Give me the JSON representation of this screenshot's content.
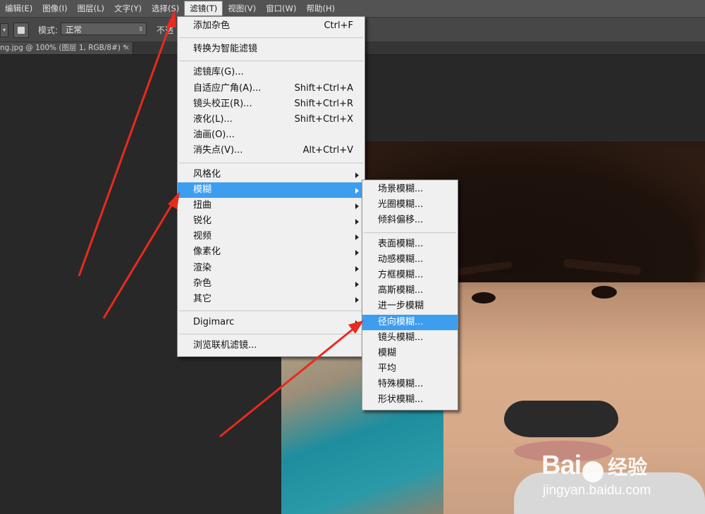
{
  "menubar": {
    "items": [
      {
        "label": "编辑(E)"
      },
      {
        "label": "图像(I)"
      },
      {
        "label": "图层(L)"
      },
      {
        "label": "文字(Y)"
      },
      {
        "label": "选择(S)"
      },
      {
        "label": "滤镜(T)"
      },
      {
        "label": "视图(V)"
      },
      {
        "label": "窗口(W)"
      },
      {
        "label": "帮助(H)"
      }
    ]
  },
  "options": {
    "mode_label": "模式:",
    "mode_value": "正常",
    "opacity_label": "不透"
  },
  "document": {
    "tab_title": "ng.jpg @ 100% (图层 1, RGB/8#) *",
    "close": "×"
  },
  "filter_menu": {
    "items": [
      {
        "label": "添加杂色",
        "shortcut": "Ctrl+F"
      },
      {
        "label": "转换为智能滤镜",
        "shortcut": ""
      },
      {
        "label": "滤镜库(G)...",
        "shortcut": ""
      },
      {
        "label": "自适应广角(A)...",
        "shortcut": "Shift+Ctrl+A"
      },
      {
        "label": "镜头校正(R)...",
        "shortcut": "Shift+Ctrl+R"
      },
      {
        "label": "液化(L)...",
        "shortcut": "Shift+Ctrl+X"
      },
      {
        "label": "油画(O)...",
        "shortcut": ""
      },
      {
        "label": "消失点(V)...",
        "shortcut": "Alt+Ctrl+V"
      },
      {
        "label": "风格化",
        "shortcut": ""
      },
      {
        "label": "模糊",
        "shortcut": ""
      },
      {
        "label": "扭曲",
        "shortcut": ""
      },
      {
        "label": "锐化",
        "shortcut": ""
      },
      {
        "label": "视频",
        "shortcut": ""
      },
      {
        "label": "像素化",
        "shortcut": ""
      },
      {
        "label": "渲染",
        "shortcut": ""
      },
      {
        "label": "杂色",
        "shortcut": ""
      },
      {
        "label": "其它",
        "shortcut": ""
      },
      {
        "label": "Digimarc",
        "shortcut": ""
      },
      {
        "label": "浏览联机滤镜...",
        "shortcut": ""
      }
    ]
  },
  "blur_submenu": {
    "items": [
      {
        "label": "场景模糊..."
      },
      {
        "label": "光圈模糊..."
      },
      {
        "label": "倾斜偏移..."
      },
      {
        "label": "表面模糊..."
      },
      {
        "label": "动感模糊..."
      },
      {
        "label": "方框模糊..."
      },
      {
        "label": "高斯模糊..."
      },
      {
        "label": "进一步模糊"
      },
      {
        "label": "径向模糊..."
      },
      {
        "label": "镜头模糊..."
      },
      {
        "label": "模糊"
      },
      {
        "label": "平均"
      },
      {
        "label": "特殊模糊..."
      },
      {
        "label": "形状模糊..."
      }
    ]
  },
  "watermark": {
    "logo_a": "Bai",
    "logo_b": "经验",
    "url": "jingyan.baidu.com"
  },
  "colors": {
    "highlight": "#3d9ef0",
    "annotation_arrow": "#e82a1f",
    "menu_bg": "#f0f0f0"
  }
}
